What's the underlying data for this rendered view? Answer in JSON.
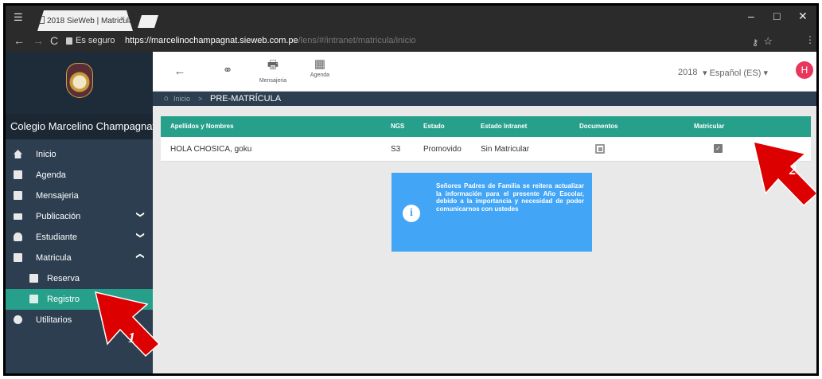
{
  "browser": {
    "tab_title": "2018 SieWeb | Matricula",
    "tab_close": "×",
    "secure_label": "Es seguro",
    "url_host": "https://marcelinochampagnat.sieweb.com.pe",
    "url_path": "/lens/#/intranet/matricula/inicio",
    "minimize": "–",
    "maximize": "□",
    "close": "✕"
  },
  "sidebar": {
    "school_name": "Colegio Marcelino Champagnat",
    "items": [
      {
        "label": "Inicio",
        "icon": "home-icon"
      },
      {
        "label": "Agenda",
        "icon": "calendar-icon"
      },
      {
        "label": "Mensajeria",
        "icon": "message-icon"
      },
      {
        "label": "Publicación",
        "icon": "publication-icon",
        "chevron": "❯"
      },
      {
        "label": "Estudiante",
        "icon": "student-icon",
        "chevron": "❯"
      },
      {
        "label": "Matricula",
        "icon": "book-icon",
        "chevron": "❯"
      },
      {
        "label": "Reserva",
        "icon": "reserve-icon"
      },
      {
        "label": "Registro",
        "icon": "register-icon"
      },
      {
        "label": "Utilitarios",
        "icon": "tools-icon"
      }
    ]
  },
  "toolbar": {
    "back": "←",
    "link": "⚭",
    "messaging_label": "Mensajeria",
    "agenda_label": "Agenda",
    "year": "2018",
    "language": "▾  Español (ES)  ▾",
    "avatar_initial": "H"
  },
  "breadcrumb": {
    "home": "Inicio",
    "separator": ">",
    "current": "PRE-MATRÍCULA"
  },
  "table": {
    "headers": [
      "Apellidos y Nombres",
      "NGS",
      "Estado",
      "Estado Intranet",
      "Documentos",
      "Matricular"
    ],
    "rows": [
      {
        "name": "HOLA CHOSICA, goku",
        "ngs": "S3",
        "estado": "Promovido",
        "estado_intranet": "Sin Matricular"
      }
    ]
  },
  "notice": {
    "icon": "i",
    "text": "Señores Padres de Familia se reitera actualizar la información para el presente Año Escolar, debido a la importancia y necesidad de poder comunicarnos con ustedes"
  },
  "annotations": {
    "arrow1": "1",
    "arrow2": "2",
    "color": "#dd0000"
  },
  "colors": {
    "sidebar": "#2c3e50",
    "accent": "#27a08b",
    "notice": "#42a5f5",
    "avatar": "#e8365d"
  }
}
